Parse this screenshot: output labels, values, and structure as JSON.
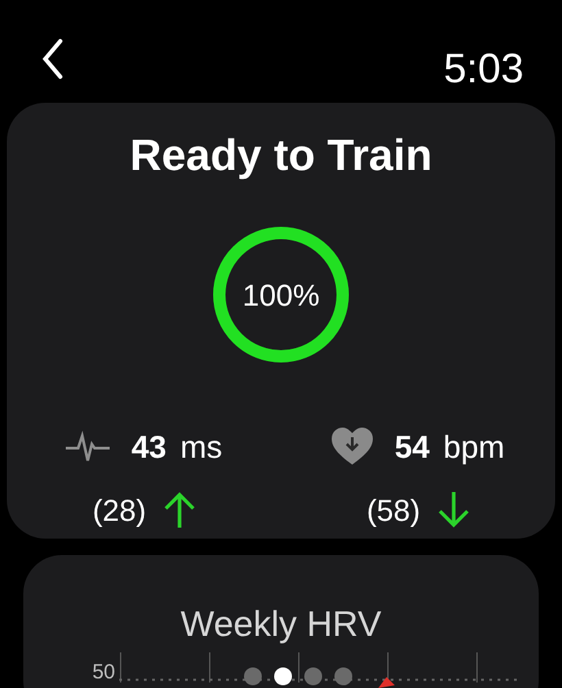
{
  "status_bar": {
    "time": "5:03"
  },
  "readiness": {
    "title": "Ready to Train",
    "score": "100%",
    "level": 1,
    "metrics": [
      {
        "kind": "hrv",
        "value": "43",
        "unit": "ms",
        "baseline": "(28)",
        "arrow": {
          "kind": "up"
        }
      },
      {
        "kind": "heart",
        "value": "54",
        "unit": "bpm",
        "baseline": "(58)",
        "arrow": {
          "kind": "down"
        }
      }
    ]
  },
  "weekly": {
    "title": "Weekly HRV",
    "y_label": "50"
  },
  "page_dots": [
    {
      "selected": false
    },
    {
      "selected": true
    },
    {
      "selected": false
    },
    {
      "selected": false
    }
  ]
}
